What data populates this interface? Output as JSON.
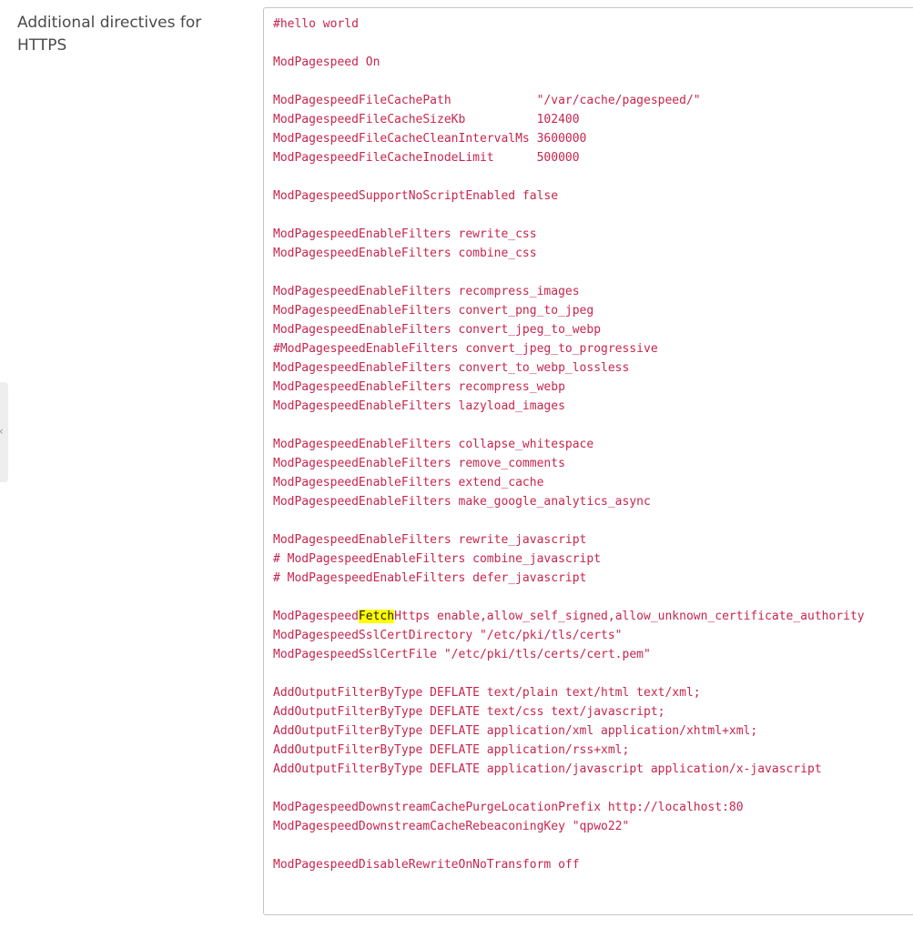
{
  "field": {
    "label": "Additional directives for HTTPS"
  },
  "side_handle": {
    "glyph": "‹"
  },
  "editor": {
    "search_highlight": "Fetch",
    "highlight_color": "#ffff00",
    "text_color": "#c7254e",
    "lines": [
      "#hello world",
      "",
      "ModPagespeed On",
      "",
      "ModPagespeedFileCachePath            \"/var/cache/pagespeed/\"",
      "ModPagespeedFileCacheSizeKb          102400",
      "ModPagespeedFileCacheCleanIntervalMs 3600000",
      "ModPagespeedFileCacheInodeLimit      500000",
      "",
      "ModPagespeedSupportNoScriptEnabled false",
      "",
      "ModPagespeedEnableFilters rewrite_css",
      "ModPagespeedEnableFilters combine_css",
      "",
      "ModPagespeedEnableFilters recompress_images",
      "ModPagespeedEnableFilters convert_png_to_jpeg",
      "ModPagespeedEnableFilters convert_jpeg_to_webp",
      "#ModPagespeedEnableFilters convert_jpeg_to_progressive",
      "ModPagespeedEnableFilters convert_to_webp_lossless",
      "ModPagespeedEnableFilters recompress_webp",
      "ModPagespeedEnableFilters lazyload_images",
      "",
      "ModPagespeedEnableFilters collapse_whitespace",
      "ModPagespeedEnableFilters remove_comments",
      "ModPagespeedEnableFilters extend_cache",
      "ModPagespeedEnableFilters make_google_analytics_async",
      "",
      "ModPagespeedEnableFilters rewrite_javascript",
      "# ModPagespeedEnableFilters combine_javascript",
      "# ModPagespeedEnableFilters defer_javascript",
      "",
      "ModPagespeedFetchHttps enable,allow_self_signed,allow_unknown_certificate_authority",
      "ModPagespeedSslCertDirectory \"/etc/pki/tls/certs\"",
      "ModPagespeedSslCertFile \"/etc/pki/tls/certs/cert.pem\"",
      "",
      "AddOutputFilterByType DEFLATE text/plain text/html text/xml;",
      "AddOutputFilterByType DEFLATE text/css text/javascript;",
      "AddOutputFilterByType DEFLATE application/xml application/xhtml+xml;",
      "AddOutputFilterByType DEFLATE application/rss+xml;",
      "AddOutputFilterByType DEFLATE application/javascript application/x-javascript",
      "",
      "ModPagespeedDownstreamCachePurgeLocationPrefix http://localhost:80",
      "ModPagespeedDownstreamCacheRebeaconingKey \"qpwo22\"",
      "",
      "ModPagespeedDisableRewriteOnNoTransform off"
    ]
  }
}
